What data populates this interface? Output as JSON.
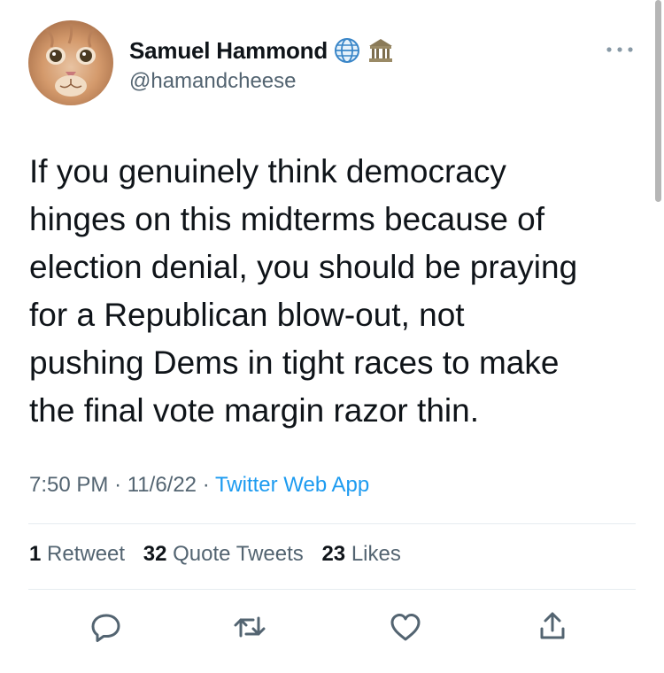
{
  "author": {
    "display_name": "Samuel Hammond",
    "handle": "@hamandcheese",
    "badges": [
      "globe-icon",
      "classical-building-icon"
    ]
  },
  "tweet": {
    "text": "If you genuinely think democracy\nhinges on this midterms because of\nelection denial, you should be praying\nfor a Republican blow-out, not\npushing Dems in tight races to make\nthe final vote margin razor thin.",
    "time": "7:50 PM",
    "date": "11/6/22",
    "separator": "·",
    "source": "Twitter Web App"
  },
  "stats": {
    "retweets_count": "1",
    "retweets_label": "Retweet",
    "quotes_count": "32",
    "quotes_label": "Quote Tweets",
    "likes_count": "23",
    "likes_label": "Likes"
  },
  "actions": [
    "reply-icon",
    "retweet-icon",
    "like-icon",
    "share-icon"
  ],
  "colors": {
    "text": "#0f1419",
    "secondary": "#536471",
    "link": "#1d9bf0",
    "divider": "#e6ecf0"
  }
}
